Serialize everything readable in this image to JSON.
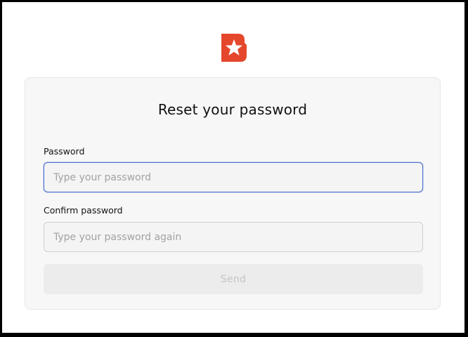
{
  "brand": {
    "logo_icon": "beacons-star-logo",
    "color": "#e5472d"
  },
  "form": {
    "title": "Reset your password",
    "password": {
      "label": "Password",
      "value": "",
      "placeholder": "Type your password"
    },
    "confirm_password": {
      "label": "Confirm password",
      "value": "",
      "placeholder": "Type your password again"
    },
    "submit": {
      "label": "Send",
      "state": "disabled"
    }
  },
  "colors": {
    "focus_border": "#4a6fd0",
    "card_background": "#f7f7f7",
    "disabled_button": "#ececec"
  }
}
